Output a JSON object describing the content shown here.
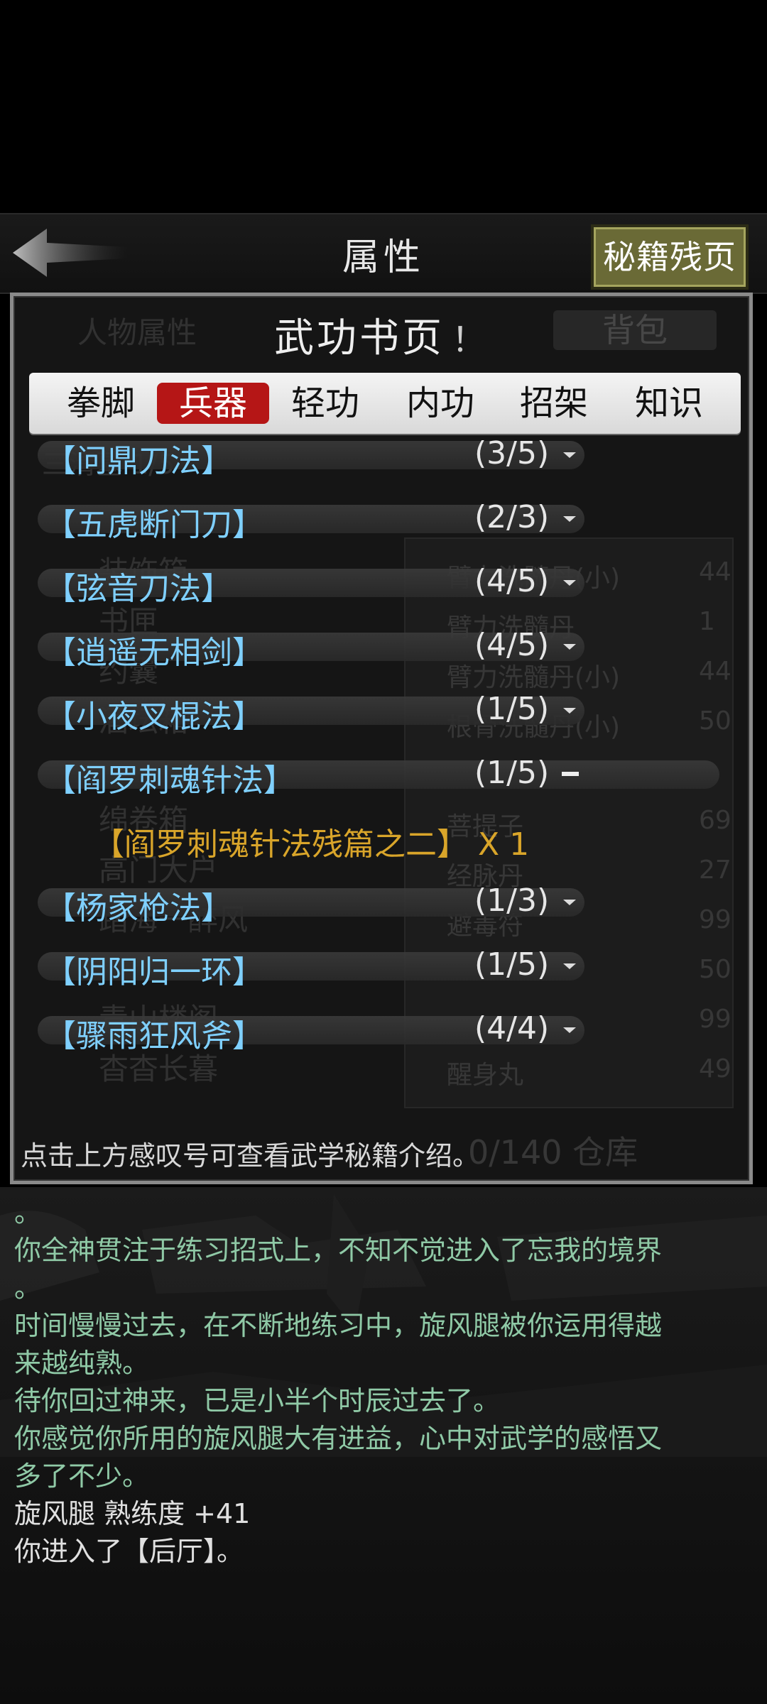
{
  "header": {
    "title": "属性",
    "secret_button": "秘籍残页"
  },
  "background": {
    "char_attr": "人物属性",
    "bag": "背包",
    "row1": "三清墓 1/5",
    "row2": "装饰箱",
    "row3": "书匣",
    "row4": "约囊",
    "row5": "酒坛箱",
    "row6": "绵卷箱",
    "row7": "高门大户",
    "row8": "踏海一醉风",
    "row9": "青山楼阁",
    "row10": "杳杳长暮",
    "inv": [
      {
        "name": "臂力洗髓丹(小)",
        "count": "44"
      },
      {
        "name": "臂力洗髓丹",
        "count": "1"
      },
      {
        "name": "臂力洗髓丹(小)",
        "count": "44"
      },
      {
        "name": "根骨洗髓丹(小)",
        "count": "50"
      },
      {
        "name": "菩提子",
        "count": "69"
      },
      {
        "name": "经脉丹",
        "count": "27"
      },
      {
        "name": "避毒符",
        "count": "99"
      },
      {
        "name": "",
        "count": "50"
      },
      {
        "name": "",
        "count": "99"
      },
      {
        "name": "醒身丸",
        "count": "49"
      }
    ],
    "storage": "0/140 仓库"
  },
  "dialog": {
    "title": "武功书页",
    "info_mark": "！",
    "tabs": [
      "拳脚",
      "兵器",
      "轻功",
      "内功",
      "招架",
      "知识"
    ],
    "active_tab": "兵器",
    "entries": [
      {
        "name": "【问鼎刀法】",
        "count": "(3/5)"
      },
      {
        "name": "【五虎断门刀】",
        "count": "(2/3)"
      },
      {
        "name": "【弦音刀法】",
        "count": "(4/5)"
      },
      {
        "name": "【逍遥无相剑】",
        "count": "(4/5)"
      },
      {
        "name": "【小夜叉棍法】",
        "count": "(1/5)"
      },
      {
        "name": "【阎罗刺魂针法】",
        "count": "(1/5)"
      },
      {
        "name": "【杨家枪法】",
        "count": "(1/3)"
      },
      {
        "name": "【阴阳归一环】",
        "count": "(1/5)"
      },
      {
        "name": "【骤雨狂风斧】",
        "count": "(4/4)"
      }
    ],
    "sub_entry": "【阎罗刺魂针法残篇之二】 X 1",
    "hint": "点击上方感叹号可查看武学秘籍介绍。"
  },
  "log": [
    "。",
    "你全神贯注于练习招式上，不知不觉进入了忘我的境界",
    "。",
    "时间慢慢过去，在不断地练习中，旋风腿被你运用得越",
    "来越纯熟。",
    "待你回过神来，已是小半个时辰过去了。",
    "你感觉你所用的旋风腿大有进益，心中对武学的感悟又",
    "多了不少。",
    "旋风腿 熟练度 +41",
    "你进入了【后厅】。"
  ]
}
